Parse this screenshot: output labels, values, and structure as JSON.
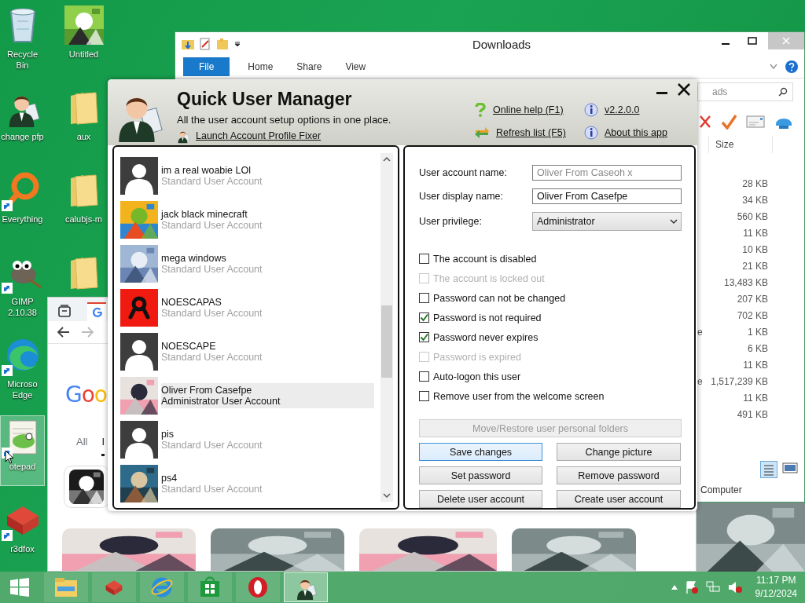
{
  "desktop": {
    "columns": [
      {
        "icons": [
          {
            "label": "Recycle Bin",
            "kind": "recycle",
            "shortcut": false,
            "selected": false
          },
          {
            "label": "change pfp",
            "kind": "user",
            "shortcut": false,
            "selected": false
          },
          {
            "label": "Everything",
            "kind": "ring",
            "shortcut": true,
            "selected": false
          },
          {
            "label": "GIMP 2.10.38",
            "kind": "gimp",
            "shortcut": true,
            "selected": false
          },
          {
            "label": "Microso Edge",
            "kind": "edge",
            "shortcut": true,
            "selected": false
          },
          {
            "label": "otepad",
            "kind": "notepad",
            "shortcut": true,
            "selected": true
          },
          {
            "label": "r3dfox",
            "kind": "fox",
            "shortcut": true,
            "selected": false
          }
        ]
      },
      {
        "icons": [
          {
            "label": "Untitled",
            "kind": "picture",
            "shortcut": false,
            "selected": false
          },
          {
            "label": "aux",
            "kind": "folder",
            "shortcut": false,
            "selected": false
          },
          {
            "label": "calubjs-m",
            "kind": "folder",
            "shortcut": false,
            "selected": false
          },
          {
            "kind": "folder",
            "shortcut": false,
            "selected": false
          }
        ]
      }
    ]
  },
  "explorer": {
    "title": "Downloads",
    "ribbon_tabs": [
      {
        "label": "File",
        "kind": "menu"
      },
      {
        "label": "Home",
        "kind": "tab"
      },
      {
        "label": "Share",
        "kind": "tab"
      },
      {
        "label": "View",
        "kind": "tab"
      }
    ],
    "search": {
      "placeholder": "ads"
    },
    "column": "Size",
    "rows": [
      {
        "size": "28 KB"
      },
      {
        "size": "34 KB"
      },
      {
        "size": "560 KB"
      },
      {
        "size": "11 KB"
      },
      {
        "size": "10 KB"
      },
      {
        "size": "21 KB"
      },
      {
        "size": "13,483 KB"
      },
      {
        "size": "207 KB"
      },
      {
        "size": "702 KB"
      },
      {
        "type": "e",
        "size": "1 KB"
      },
      {
        "size": "6 KB"
      },
      {
        "size": "11 KB"
      },
      {
        "type": "e",
        "size": "1,517,239 KB"
      },
      {
        "size": "11 KB"
      },
      {
        "size": "491 KB"
      }
    ],
    "status": "Computer"
  },
  "browser": {
    "logo": "Goo",
    "tabs": [
      {
        "label": "All",
        "selected": false
      },
      {
        "label": "I",
        "selected": true
      }
    ]
  },
  "qum": {
    "title": "Quick User Manager",
    "subtitle": "All the user account setup options in one place.",
    "fixer_link": "Launch Account Profile Fixer",
    "links": [
      {
        "label": "Online help (F1)",
        "kind": "help"
      },
      {
        "label": "v2.2.0.0",
        "kind": "info"
      },
      {
        "label": "Refresh list (F5)",
        "kind": "refresh"
      },
      {
        "label": "About this app",
        "kind": "info"
      }
    ],
    "users": [
      {
        "name": "im a real woabie LOl",
        "role": "Standard User Account",
        "kind": "default",
        "selected": false
      },
      {
        "name": "jack black minecraft",
        "role": "Standard User Account",
        "kind": "picture",
        "selected": false
      },
      {
        "name": "mega windows",
        "role": "Standard User Account",
        "kind": "picture",
        "selected": false
      },
      {
        "name": "NOESCAPAS",
        "role": "Standard User Account",
        "kind": "figure",
        "selected": false
      },
      {
        "name": "NOESCAPE",
        "role": "Standard User Account",
        "kind": "default",
        "selected": false
      },
      {
        "name": "Oliver From Casefpe",
        "role": "Administrator User Account",
        "kind": "picture",
        "selected": true
      },
      {
        "name": "pis",
        "role": "Standard User Account",
        "kind": "default",
        "selected": false
      },
      {
        "name": "ps4",
        "role": "Standard User Account",
        "kind": "picture",
        "selected": false
      }
    ],
    "fields": [
      {
        "label": "User account name:",
        "value": "Oliver From Caseoh x",
        "disabled": true
      },
      {
        "label": "User display name:",
        "value": "Oliver From Casefpe",
        "disabled": false
      }
    ],
    "privilege": {
      "label": "User privilege:",
      "value": "Administrator"
    },
    "checkboxes": [
      {
        "label": "The account is disabled",
        "checked": false,
        "disabled": false
      },
      {
        "label": "The account is locked out",
        "checked": false,
        "disabled": true
      },
      {
        "label": "Password can not be changed",
        "checked": false,
        "disabled": false
      },
      {
        "label": "Password is not required",
        "checked": true,
        "disabled": false
      },
      {
        "label": "Password never expires",
        "checked": true,
        "disabled": false
      },
      {
        "label": "Password is expired",
        "checked": false,
        "disabled": true
      },
      {
        "label": "Auto-logon this user",
        "checked": false,
        "disabled": false
      },
      {
        "label": "Remove user from the welcome screen",
        "checked": false,
        "disabled": false
      }
    ],
    "wide_button": {
      "label": "Move/Restore user personal folders",
      "disabled": true
    },
    "buttons": [
      {
        "label": "Save changes",
        "default": true,
        "disabled": false
      },
      {
        "label": "Change picture",
        "default": false,
        "disabled": false
      },
      {
        "label": "Set password",
        "default": false,
        "disabled": false
      },
      {
        "label": "Remove password",
        "default": false,
        "disabled": false
      },
      {
        "label": "Delete user account",
        "default": false,
        "disabled": false
      },
      {
        "label": "Create user account",
        "default": false,
        "disabled": false
      }
    ]
  },
  "taskbar": {
    "apps": [
      {
        "kind": "explorer",
        "active": false
      },
      {
        "kind": "fox",
        "active": false
      },
      {
        "kind": "ie",
        "active": false
      },
      {
        "kind": "store",
        "active": false
      },
      {
        "kind": "opera",
        "active": false
      },
      {
        "kind": "user",
        "active": true
      }
    ],
    "time": "11:17 PM",
    "date": "9/12/2024"
  }
}
